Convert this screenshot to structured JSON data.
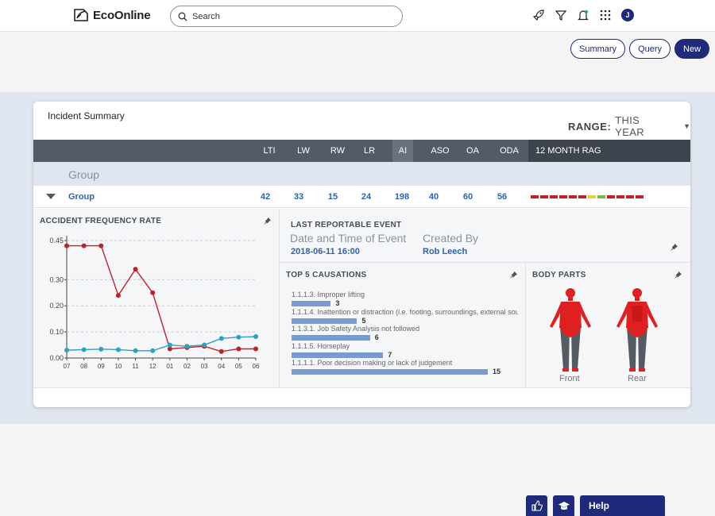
{
  "app": {
    "name": "EcoOnline"
  },
  "search": {
    "placeholder": "Search"
  },
  "user": {
    "initial": "J"
  },
  "icons": {
    "logo": "ecoonline-logo-icon",
    "search": "search-icon",
    "rocket": "rocket-icon",
    "filter": "filter-icon",
    "bell": "bell-icon",
    "apps": "apps-grid-icon",
    "pin": "pin-icon",
    "like": "thumbs-up-icon",
    "learn": "graduation-cap-icon"
  },
  "actions": {
    "summary": "Summary",
    "query": "Query",
    "new": "New"
  },
  "card": {
    "title": "Incident Summary",
    "range_label": "RANGE:",
    "range_value": "THIS YEAR"
  },
  "columns": [
    "LTI",
    "LW",
    "RW",
    "LR",
    "AI",
    "ASO",
    "OA",
    "ODA"
  ],
  "rag_header": "12 MONTH RAG",
  "group_header": "Group",
  "group_row": {
    "name": "Group",
    "values": [
      "42",
      "33",
      "15",
      "24",
      "198",
      "40",
      "60",
      "56"
    ],
    "rag": [
      "#c0202a",
      "#c0202a",
      "#c0202a",
      "#c0202a",
      "#c0202a",
      "#c0202a",
      "#e5cf2a",
      "#7ab648",
      "#c0202a",
      "#c0202a",
      "#c0202a",
      "#c0202a"
    ]
  },
  "colors": {
    "accent": "#1f2a7a",
    "link": "#2f63ad",
    "red": "#c0202a",
    "teal": "#2fa0bf",
    "bar": "#7a9bd1"
  },
  "afr": {
    "title": "ACCIDENT FREQUENCY RATE"
  },
  "chart_data": {
    "type": "line",
    "title": "",
    "xlabel": "",
    "ylabel": "",
    "categories": [
      "07",
      "08",
      "09",
      "10",
      "11",
      "12",
      "01",
      "02",
      "03",
      "04",
      "05",
      "06"
    ],
    "ylim": [
      0,
      0.45
    ],
    "yticks": [
      "0.00",
      "0.10",
      "0.20",
      "0.30",
      "0.45"
    ],
    "grid": true,
    "series": [
      {
        "color": "#c0202a",
        "values": [
          0.43,
          0.43,
          0.43,
          0.24,
          0.34,
          0.25,
          0.035,
          0.04,
          0.045,
          0.025,
          0.035,
          0.035
        ]
      },
      {
        "color": "#2fa0bf",
        "values": [
          0.03,
          0.032,
          0.034,
          0.032,
          0.028,
          0.028,
          0.05,
          0.045,
          0.05,
          0.075,
          0.08,
          0.082
        ]
      }
    ]
  },
  "last_event": {
    "title": "LAST REPORTABLE EVENT",
    "date_label": "Date and Time of Event",
    "date_value": "2018-06-11 16:00",
    "created_label": "Created By",
    "created_value": "Rob Leech"
  },
  "causations": {
    "title": "TOP 5 CAUSATIONS",
    "max": 15,
    "items": [
      {
        "label": "1.1.1.3. Improper lifting",
        "value": 3
      },
      {
        "label": "1.1.1.4. Inattention or distraction (i.e. footing, surroundings, external sou",
        "value": 5
      },
      {
        "label": "1.1.3.1. Job Safety Analysis not followed",
        "value": 6
      },
      {
        "label": "1.1.1.5. Horseplay",
        "value": 7
      },
      {
        "label": "1.1.1.1. Poor decision making or lack of judgement",
        "value": 15
      }
    ]
  },
  "body_parts": {
    "title": "BODY PARTS",
    "front": "Front",
    "rear": "Rear"
  },
  "help": {
    "label": "Help"
  }
}
